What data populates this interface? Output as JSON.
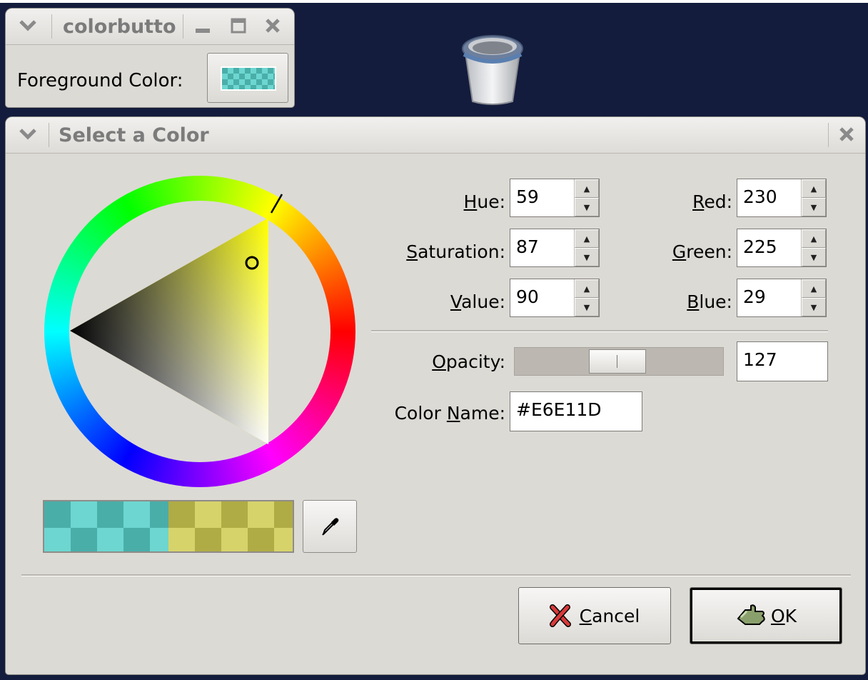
{
  "colorbutton_window": {
    "title": "colorbutto",
    "label_text": "Foreground Color:"
  },
  "desktop": {
    "trash_icon": "trash-icon"
  },
  "dialog": {
    "title": "Select a Color",
    "hue": {
      "label_u": "H",
      "label_rest": "ue:",
      "value": "59"
    },
    "saturation": {
      "label_u": "S",
      "label_rest": "aturation:",
      "value": "87"
    },
    "value": {
      "label_u": "V",
      "label_rest": "alue:",
      "value": "90"
    },
    "red": {
      "label_u": "R",
      "label_rest": "ed:",
      "value": "230"
    },
    "green": {
      "label_u": "G",
      "label_rest": "reen:",
      "value": "225"
    },
    "blue": {
      "label_u": "B",
      "label_rest": "lue:",
      "value": "29"
    },
    "opacity": {
      "label_u": "O",
      "label_rest": "pacity:",
      "value": "127",
      "fraction": 0.5
    },
    "color_name": {
      "label_pre": "Color ",
      "label_u": "N",
      "label_rest": "ame:",
      "value": "#E6E11D"
    },
    "cancel": {
      "label_u": "C",
      "label_rest": "ancel"
    },
    "ok": {
      "label_u": "O",
      "label_rest": "K"
    }
  },
  "colors": {
    "selected": "#E6E11D",
    "previous": "#4AAEA8",
    "title_text": "#7B7B7B",
    "window_bg": "#DCDAD5",
    "desktop_bg": "#131C3C"
  }
}
